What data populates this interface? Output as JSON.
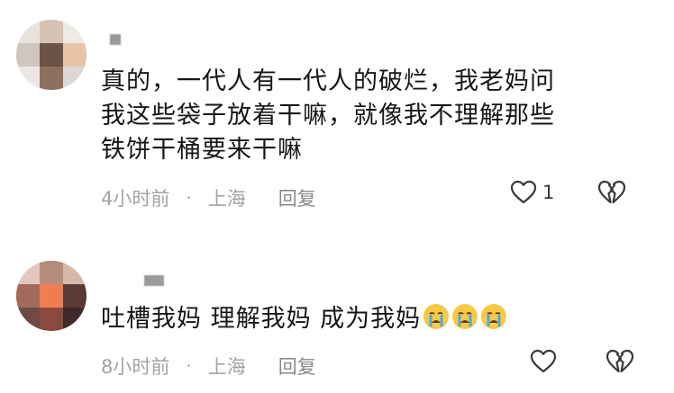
{
  "comments": [
    {
      "text_lines": [
        "真的，一代人有一代人的破烂，我老妈问",
        "我这些袋子放着干嘛，就像我不理解那些",
        "铁饼干桶要来干嘛"
      ],
      "time": "4小时前",
      "location": "上海",
      "reply_label": "回复",
      "like_count": "1",
      "icons": {
        "like": "heart-outline-icon",
        "dislike": "broken-heart-icon"
      }
    },
    {
      "text": "吐槽我妈 理解我妈 成为我妈",
      "emoji": [
        "crying-face-emoji",
        "crying-face-emoji",
        "crying-face-emoji"
      ],
      "time": "8小时前",
      "location": "上海",
      "reply_label": "回复",
      "like_count": "",
      "icons": {
        "like": "heart-outline-icon",
        "dislike": "broken-heart-icon"
      }
    }
  ],
  "separator": "·",
  "colors": {
    "text": "#161616",
    "meta": "#a3a3a3",
    "icon": "#3a3a3a",
    "emoji_face": "#f7c944",
    "emoji_tear": "#4aa8e6"
  }
}
